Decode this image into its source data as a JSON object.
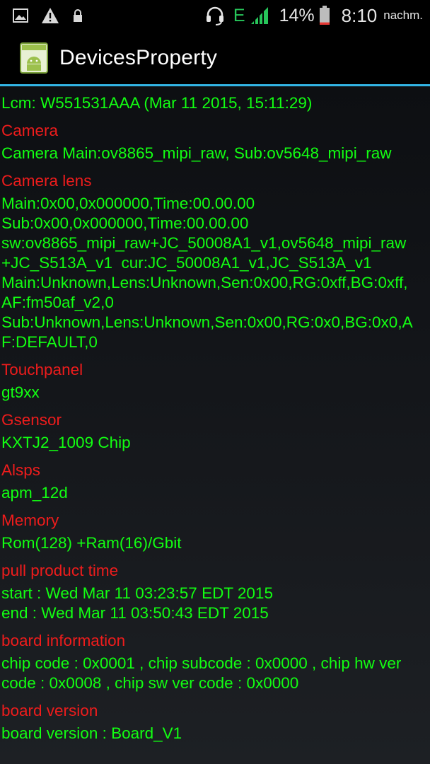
{
  "colors": {
    "header_red": "#ee1c1c",
    "value_green": "#12ff12",
    "action_bar_divider": "#33b5e5",
    "network_green": "#27c65a"
  },
  "status_bar": {
    "left_icons": [
      "image-icon",
      "warning-icon",
      "lock-icon"
    ],
    "right_icons": [
      "headset-icon",
      "signal-icon",
      "battery-icon"
    ],
    "network_type": "E",
    "battery_percent": "14%",
    "battery_level": 0.14,
    "time": "8:10",
    "time_suffix": "nachm."
  },
  "action_bar": {
    "icon": "android-app-icon",
    "title": "DevicesProperty"
  },
  "content": {
    "lcm": "Lcm: W551531AAA (Mar 11 2015, 15:11:29)",
    "camera": {
      "header": "Camera",
      "lines": [
        "Camera Main:ov8865_mipi_raw, Sub:ov5648_mipi_raw"
      ]
    },
    "camera_lens": {
      "header": "Camera lens",
      "lines": [
        "Main:0x00,0x000000,Time:00.00.00",
        "Sub:0x00,0x000000,Time:00.00.00",
        "sw:ov8865_mipi_raw+JC_50008A1_v1,ov5648_mipi_raw",
        "+JC_S513A_v1  cur:JC_50008A1_v1,JC_S513A_v1",
        "Main:Unknown,Lens:Unknown,Sen:0x00,RG:0xff,BG:0xff,",
        "AF:fm50af_v2,0",
        "Sub:Unknown,Lens:Unknown,Sen:0x00,RG:0x0,BG:0x0,A",
        "F:DEFAULT,0"
      ]
    },
    "touchpanel": {
      "header": "Touchpanel",
      "lines": [
        "gt9xx"
      ]
    },
    "gsensor": {
      "header": "Gsensor",
      "lines": [
        "KXTJ2_1009 Chip"
      ]
    },
    "alsps": {
      "header": "Alsps",
      "lines": [
        "apm_12d"
      ]
    },
    "memory": {
      "header": "Memory",
      "lines": [
        "Rom(128) +Ram(16)/Gbit"
      ]
    },
    "pull_product_time": {
      "header": "pull product time",
      "lines": [
        "start : Wed Mar 11 03:23:57 EDT 2015",
        "end : Wed Mar 11 03:50:43 EDT 2015"
      ]
    },
    "board_information": {
      "header": "board information",
      "lines": [
        "chip code : 0x0001 , chip subcode : 0x0000 , chip hw ver",
        "code : 0x0008 , chip sw ver code : 0x0000"
      ]
    },
    "board_version": {
      "header": "board version",
      "lines": [
        "board version : Board_V1"
      ]
    }
  }
}
